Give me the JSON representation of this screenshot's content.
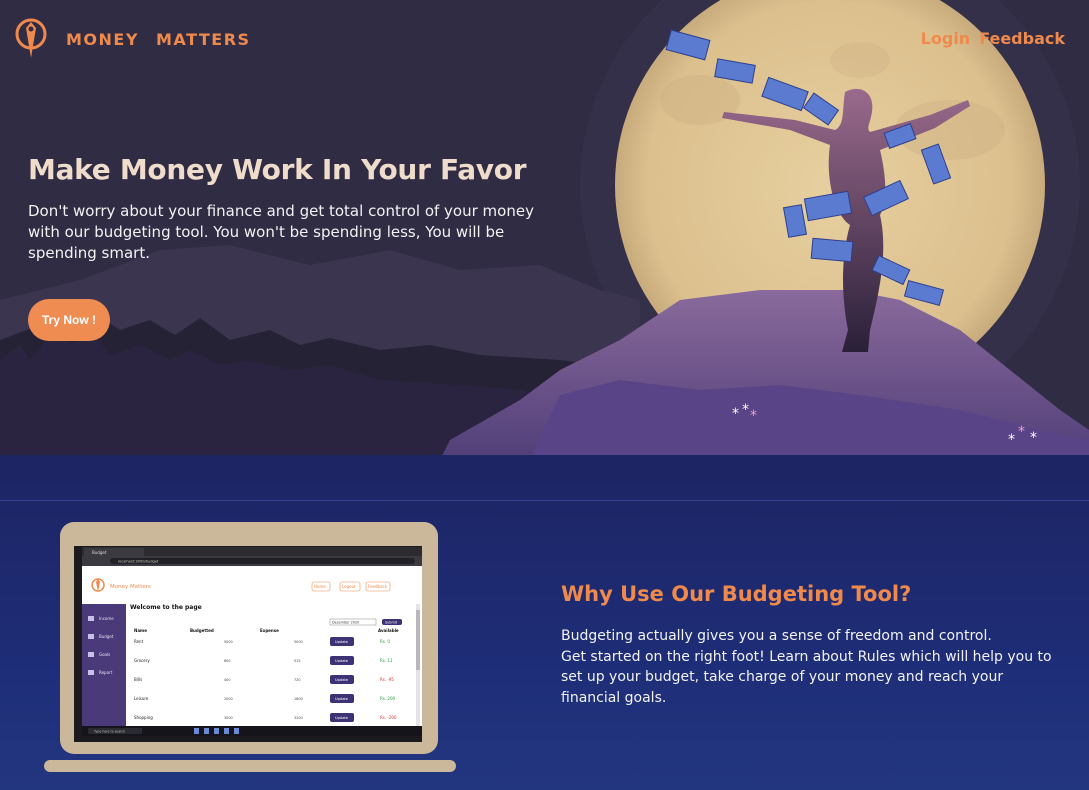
{
  "brand": {
    "name": "MONEY MATTERS"
  },
  "nav": {
    "login": "Login",
    "feedback": "Feedback"
  },
  "hero": {
    "title": "Make Money Work In Your Favor",
    "text": "Don't worry about your finance and get total control of your money with our budgeting tool. You won't be spending less, You will be spending smart.",
    "cta": "Try Now !"
  },
  "why": {
    "title": "Why Use Our Budgeting Tool?",
    "line1": "Budgeting actually gives you a sense of freedom and control.",
    "line2": "Get started on the right foot! Learn about Rules which will help you to set up your budget, take charge of your money and reach your financial goals."
  },
  "screenshot": {
    "tab": "Budget",
    "address": "localhost:3000/budget",
    "brand": "Money Matters",
    "nav": [
      "Home",
      "Logout",
      "Feedback"
    ],
    "welcome": "Welcome to the page",
    "month": "December 2020",
    "submit": "Submit",
    "sidebar": [
      "Income",
      "Budget",
      "Goals",
      "Report"
    ],
    "headers": [
      "Name",
      "Budgetted",
      "Expense",
      "Available"
    ],
    "rows": [
      {
        "name": "Rent",
        "budget": "5000",
        "expense": "5000",
        "avail": "Rs. 0",
        "neg": false
      },
      {
        "name": "Grocery",
        "budget": "800",
        "expense": "515",
        "avail": "Rs. 11",
        "neg": false
      },
      {
        "name": "Bills",
        "budget": "400",
        "expense": "720",
        "avail": "Rs. -95",
        "neg": true
      },
      {
        "name": "Leisure",
        "budget": "2000",
        "expense": "1800",
        "avail": "Rs. 200",
        "neg": false
      },
      {
        "name": "Shopping",
        "budget": "3000",
        "expense": "3200",
        "avail": "Rs. -200",
        "neg": true
      }
    ],
    "update": "Update",
    "search": "Type here to search"
  },
  "colors": {
    "accent": "#ef8a4c",
    "hero_bg": "#302c44",
    "lower_bg": "#1e2d77",
    "title": "#f0dccb"
  },
  "icons": [
    "logo-icon",
    "income-icon",
    "budget-icon",
    "goals-icon",
    "report-icon"
  ]
}
